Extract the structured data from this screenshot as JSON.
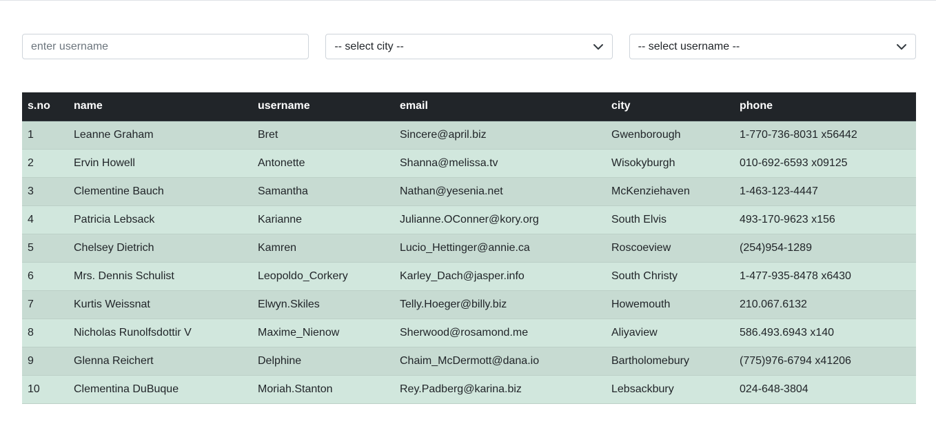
{
  "filters": {
    "username_placeholder": "enter username",
    "city_select": "-- select city --",
    "username_select": "-- select username --"
  },
  "table": {
    "headers": [
      "s.no",
      "name",
      "username",
      "email",
      "city",
      "phone"
    ],
    "rows": [
      [
        "1",
        "Leanne Graham",
        "Bret",
        "Sincere@april.biz",
        "Gwenborough",
        "1-770-736-8031 x56442"
      ],
      [
        "2",
        "Ervin Howell",
        "Antonette",
        "Shanna@melissa.tv",
        "Wisokyburgh",
        "010-692-6593 x09125"
      ],
      [
        "3",
        "Clementine Bauch",
        "Samantha",
        "Nathan@yesenia.net",
        "McKenziehaven",
        "1-463-123-4447"
      ],
      [
        "4",
        "Patricia Lebsack",
        "Karianne",
        "Julianne.OConner@kory.org",
        "South Elvis",
        "493-170-9623 x156"
      ],
      [
        "5",
        "Chelsey Dietrich",
        "Kamren",
        "Lucio_Hettinger@annie.ca",
        "Roscoeview",
        "(254)954-1289"
      ],
      [
        "6",
        "Mrs. Dennis Schulist",
        "Leopoldo_Corkery",
        "Karley_Dach@jasper.info",
        "South Christy",
        "1-477-935-8478 x6430"
      ],
      [
        "7",
        "Kurtis Weissnat",
        "Elwyn.Skiles",
        "Telly.Hoeger@billy.biz",
        "Howemouth",
        "210.067.6132"
      ],
      [
        "8",
        "Nicholas Runolfsdottir V",
        "Maxime_Nienow",
        "Sherwood@rosamond.me",
        "Aliyaview",
        "586.493.6943 x140"
      ],
      [
        "9",
        "Glenna Reichert",
        "Delphine",
        "Chaim_McDermott@dana.io",
        "Bartholomebury",
        "(775)976-6794 x41206"
      ],
      [
        "10",
        "Clementina DuBuque",
        "Moriah.Stanton",
        "Rey.Padberg@karina.biz",
        "Lebsackbury",
        "024-648-3804"
      ]
    ]
  },
  "icons": {
    "city_select_icon": "chevron-down-icon",
    "username_select_icon": "chevron-down-icon"
  }
}
